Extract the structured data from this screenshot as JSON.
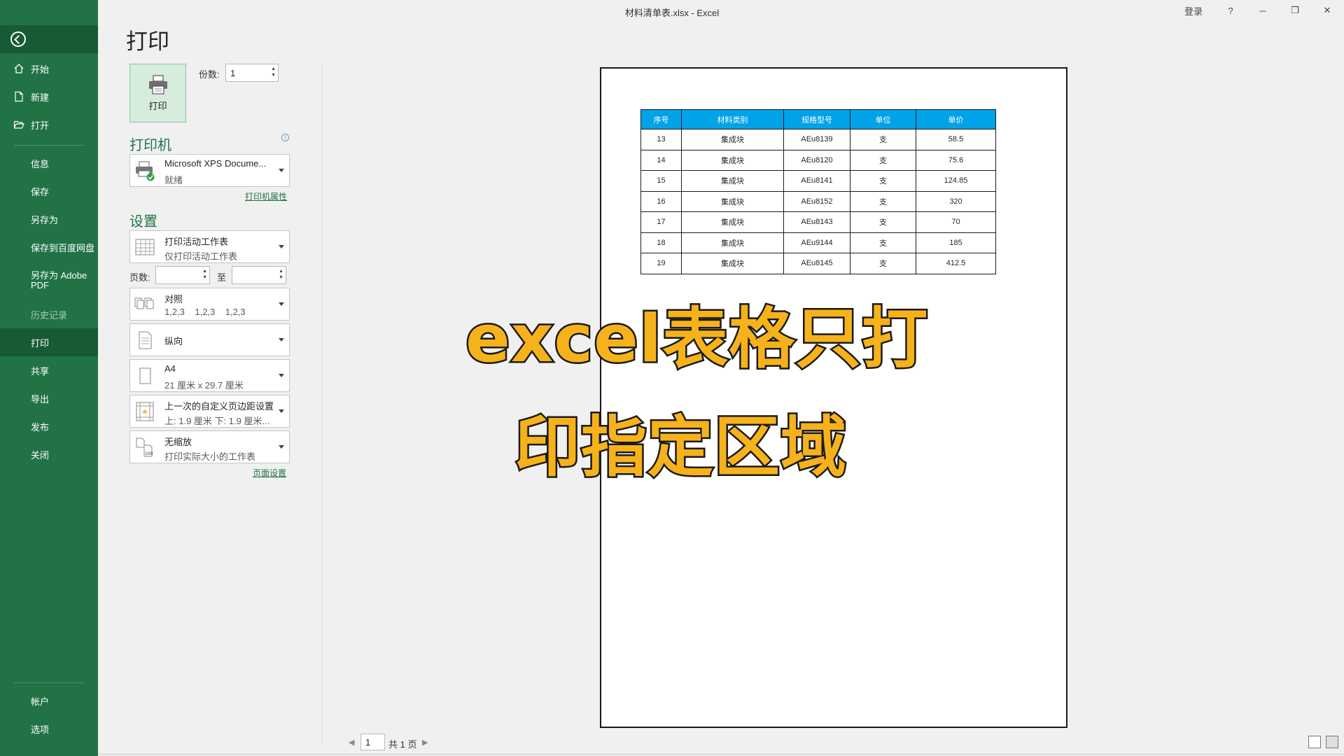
{
  "titlebar": {
    "title": "材料清单表.xlsx  -  Excel",
    "login": "登录",
    "help": "?",
    "minimize": "─",
    "restore": "❐",
    "close": "✕"
  },
  "sidebar": {
    "items": [
      {
        "label": "开始",
        "icon": "home-icon"
      },
      {
        "label": "新建",
        "icon": "new-file-icon"
      },
      {
        "label": "打开",
        "icon": "open-folder-icon"
      },
      {
        "label": "信息"
      },
      {
        "label": "保存"
      },
      {
        "label": "另存为"
      },
      {
        "label": "保存到百度网盘"
      },
      {
        "label": "另存为 Adobe PDF"
      },
      {
        "label": "历史记录"
      },
      {
        "label": "打印"
      },
      {
        "label": "共享"
      },
      {
        "label": "导出"
      },
      {
        "label": "发布"
      },
      {
        "label": "关闭"
      }
    ],
    "bottom": [
      {
        "label": "帐户"
      },
      {
        "label": "选项"
      }
    ]
  },
  "print": {
    "title": "打印",
    "print_button": "打印",
    "copies_label": "份数:",
    "copies_value": "1"
  },
  "printer": {
    "section": "打印机",
    "name": "Microsoft XPS Docume...",
    "status": "就绪",
    "properties_link": "打印机属性"
  },
  "settings": {
    "section": "设置",
    "scope": {
      "main": "打印活动工作表",
      "sub": "仅打印活动工作表"
    },
    "pages_label": "页数:",
    "pages_to": "至",
    "collate": {
      "main": "对照",
      "sub": "1,2,3    1,2,3    1,2,3"
    },
    "orientation": {
      "main": "纵向"
    },
    "paper": {
      "main": "A4",
      "sub": "21 厘米 x 29.7 厘米"
    },
    "margins": {
      "main": "上一次的自定义页边距设置",
      "sub": "上: 1.9 厘米 下: 1.9 厘米..."
    },
    "scaling": {
      "main": "无缩放",
      "sub": "打印实际大小的工作表"
    },
    "page_setup_link": "页面设置"
  },
  "preview": {
    "headers": [
      "序号",
      "材料类别",
      "规格型号",
      "单位",
      "单价"
    ],
    "rows": [
      [
        "13",
        "集成块",
        "AEu8139",
        "支",
        "58.5"
      ],
      [
        "14",
        "集成块",
        "AEu8120",
        "支",
        "75.6"
      ],
      [
        "15",
        "集成块",
        "AEu8141",
        "支",
        "124.85"
      ],
      [
        "16",
        "集成块",
        "AEu8152",
        "支",
        "320"
      ],
      [
        "17",
        "集成块",
        "AEu8143",
        "支",
        "70"
      ],
      [
        "18",
        "集成块",
        "AEu9144",
        "支",
        "185"
      ],
      [
        "19",
        "集成块",
        "AEu8145",
        "支",
        "412.5"
      ]
    ],
    "header_color": "#00a2e8"
  },
  "overlay": {
    "line1": "excel表格只打",
    "line2": "印指定区域",
    "color": "#f6b21b"
  },
  "pager": {
    "current": "1",
    "total": "共 1 页"
  },
  "theme": {
    "accent": "#217346"
  }
}
